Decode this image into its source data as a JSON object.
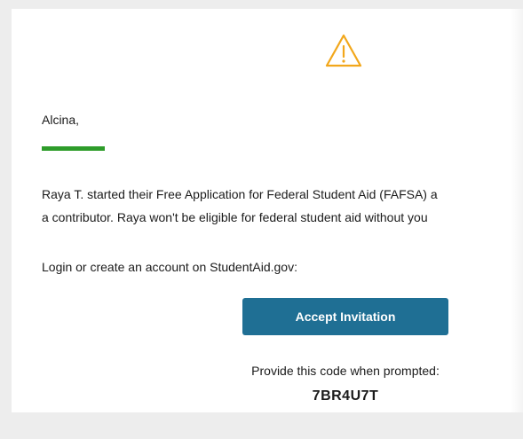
{
  "email": {
    "icon": "warning-triangle-icon",
    "greeting": "Alcina,",
    "body_line_1": "Raya T. started their Free Application for Federal Student Aid (FAFSA) a",
    "body_line_2": "a contributor. Raya won't be eligible for federal student aid without you",
    "login_instruction": "Login or create an account on StudentAid.gov:",
    "accept_button_label": "Accept Invitation",
    "code_prompt": "Provide this code when prompted:",
    "code": "7BR4U7T"
  },
  "colors": {
    "accent_green": "#2e9c2a",
    "button_blue": "#1f6f94",
    "warning_orange": "#f2a71b",
    "page_background": "#ededed",
    "card_background": "#ffffff"
  }
}
